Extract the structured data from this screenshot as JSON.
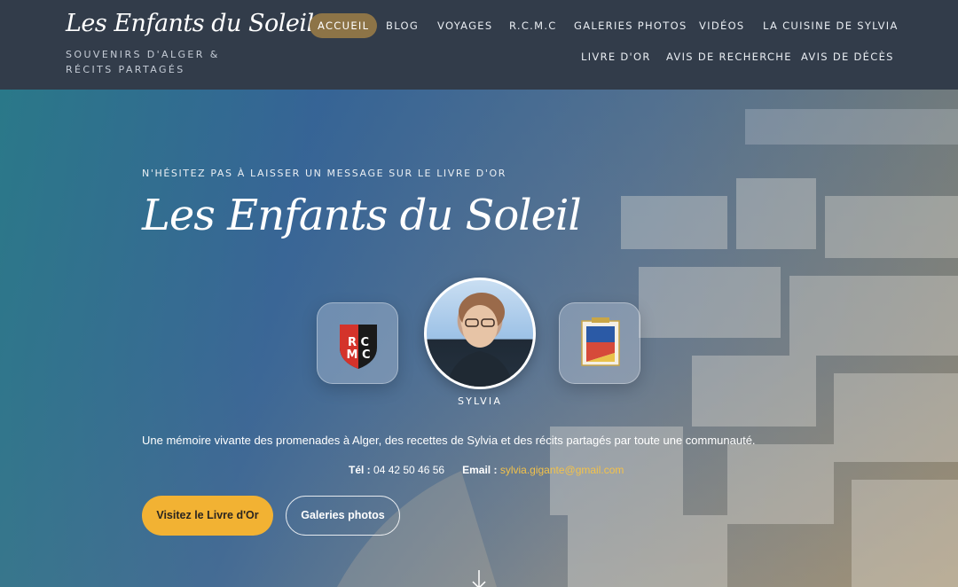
{
  "header": {
    "logo_script": "Les Enfants du Soleil",
    "tagline": "SOUVENIRS D'ALGER & RÉCITS PARTAGÉS",
    "nav": [
      {
        "label": "ACCUEIL",
        "active": true
      },
      {
        "label": "BLOG"
      },
      {
        "label": "VOYAGES"
      },
      {
        "label": "R.C.M.C"
      },
      {
        "label": "GALERIES PHOTOS"
      },
      {
        "label": "VIDÉOS"
      },
      {
        "label": "LA CUISINE DE SYLVIA"
      },
      {
        "label": "LIVRE D'OR"
      },
      {
        "label": "AVIS DE RECHERCHE"
      },
      {
        "label": "AVIS DE DÉCÈS"
      }
    ]
  },
  "hero": {
    "pre_title": "N'HÉSITEZ PAS À LAISSER UN MESSAGE SUR LE LIVRE D'OR",
    "title": "Les Enfants du Soleil",
    "avatar_label": "SYLVIA",
    "badge_left": "rcmc-logo",
    "badge_right": "coat-of-arms-logo",
    "intro": "Une mémoire vivante des promenades à Alger, des recettes de Sylvia et des récits partagés par toute une communauté.",
    "contact": {
      "tel_label": "Tél :",
      "tel_value": "04 42 50 46 56",
      "email_label": "Email :",
      "email_value": "sylvia.gigante@gmail.com"
    },
    "primary_button": "Visitez le Livre d'Or",
    "secondary_button": "Galeries photos",
    "scroll_icon": "arrow-down-icon"
  },
  "colors": {
    "header_bg": "#323c4a",
    "nav_active_bg": "#8d7447",
    "primary_button": "#f2b233",
    "email_link": "#f3c24a"
  }
}
